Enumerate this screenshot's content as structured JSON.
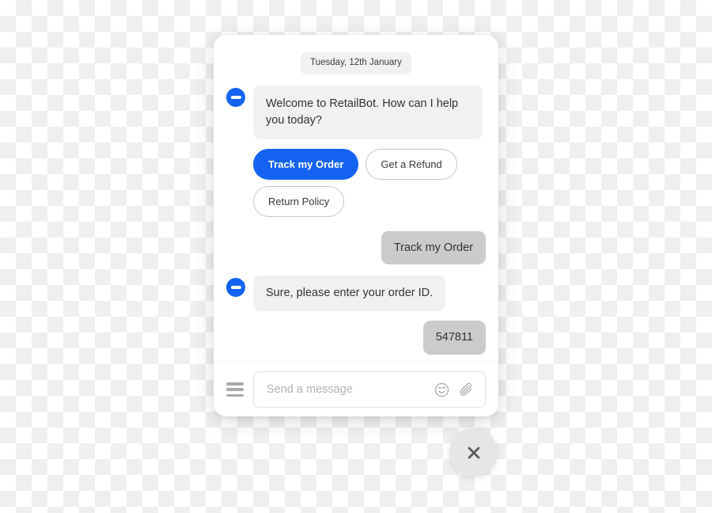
{
  "widget": {
    "date_divider": "Tuesday, 12th January",
    "accent_color": "#1463f3",
    "bot_bubble_color": "#f1f1f2",
    "user_bubble_color": "#cbcbcb"
  },
  "messages": [
    {
      "sender": "bot",
      "text": "Welcome to RetailBot. How can I help you today?",
      "avatar_icon": "minus-circle-icon"
    },
    {
      "sender": "user",
      "text": "Track my Order"
    },
    {
      "sender": "bot",
      "text": "Sure, please enter your order ID.",
      "avatar_icon": "minus-circle-icon"
    },
    {
      "sender": "user",
      "text": "547811"
    }
  ],
  "quick_replies": [
    {
      "label": "Track my Order",
      "style": "primary"
    },
    {
      "label": "Get a Refund",
      "style": "ghost"
    },
    {
      "label": "Return Policy",
      "style": "ghost"
    }
  ],
  "composer": {
    "menu_icon": "hamburger-menu-icon",
    "placeholder": "Send a message",
    "value": "",
    "emoji_icon": "smiley-face-icon",
    "attach_icon": "paperclip-icon"
  },
  "launcher": {
    "close_icon": "close-x-icon"
  }
}
